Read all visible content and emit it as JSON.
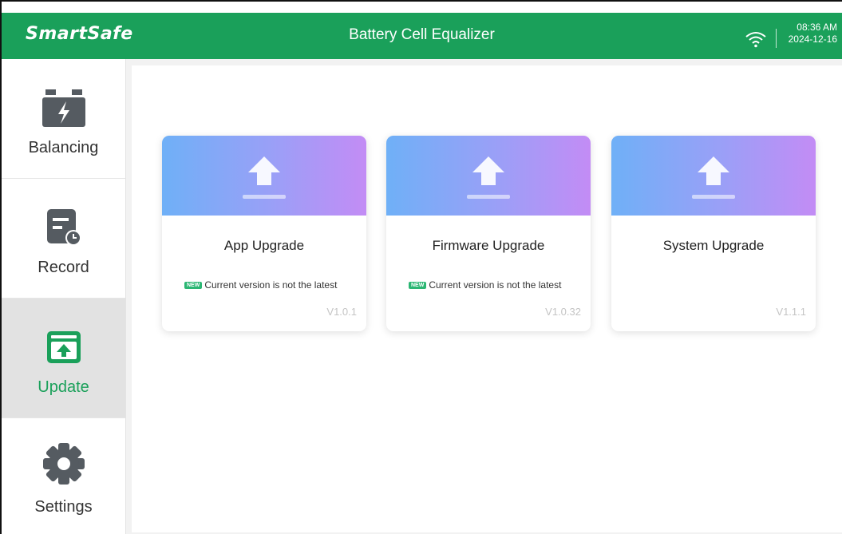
{
  "header": {
    "logo": "SmartSafe",
    "title": "Battery Cell Equalizer",
    "time": "08:36 AM",
    "date": "2024-12-16",
    "wifi_icon": "wifi-icon"
  },
  "sidebar": {
    "items": [
      {
        "label": "Balancing",
        "icon": "battery-bolt-icon",
        "active": false
      },
      {
        "label": "Record",
        "icon": "record-clock-icon",
        "active": false
      },
      {
        "label": "Update",
        "icon": "upload-box-icon",
        "active": true
      },
      {
        "label": "Settings",
        "icon": "gear-icon",
        "active": false
      }
    ]
  },
  "cards": [
    {
      "title": "App Upgrade",
      "badge": "NEW",
      "notice": "Current version is not the latest",
      "version": "V1.0.1"
    },
    {
      "title": "Firmware Upgrade",
      "badge": "NEW",
      "notice": "Current version is not the latest",
      "version": "V1.0.32"
    },
    {
      "title": "System Upgrade",
      "version": "V1.1.1"
    }
  ],
  "colors": {
    "brand": "#1aa05a",
    "badge": "#2bb673",
    "inactive_icon": "#555b61"
  }
}
